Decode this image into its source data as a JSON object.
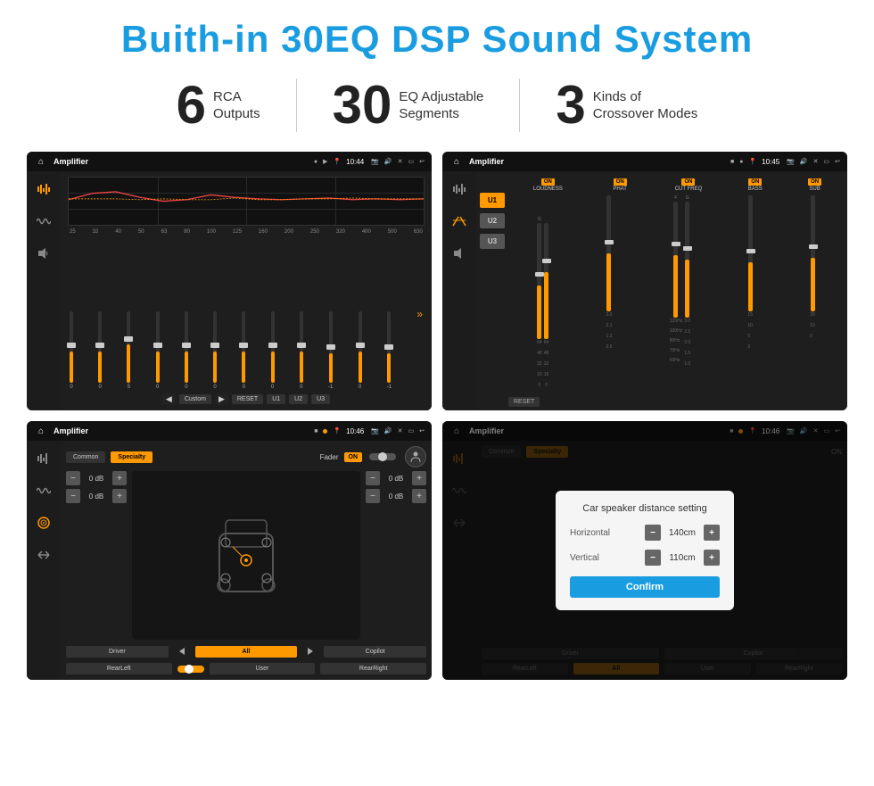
{
  "title": "Buith-in 30EQ DSP Sound System",
  "stats": [
    {
      "number": "6",
      "text_line1": "RCA",
      "text_line2": "Outputs"
    },
    {
      "number": "30",
      "text_line1": "EQ Adjustable",
      "text_line2": "Segments"
    },
    {
      "number": "3",
      "text_line1": "Kinds of",
      "text_line2": "Crossover Modes"
    }
  ],
  "screens": {
    "eq_screen": {
      "status_bar": {
        "app": "Amplifier",
        "time": "10:44"
      },
      "eq_labels": [
        "25",
        "32",
        "40",
        "50",
        "63",
        "80",
        "100",
        "125",
        "160",
        "200",
        "250",
        "320",
        "400",
        "500",
        "630"
      ],
      "eq_values": [
        "0",
        "0",
        "0",
        "5",
        "0",
        "0",
        "0",
        "0",
        "0",
        "0",
        "0",
        "-1",
        "0",
        "-1"
      ],
      "buttons": [
        "Custom",
        "RESET",
        "U1",
        "U2",
        "U3"
      ]
    },
    "crossover_screen": {
      "status_bar": {
        "app": "Amplifier",
        "time": "10:45"
      },
      "presets": [
        "U1",
        "U2",
        "U3"
      ],
      "channels": [
        {
          "name": "LOUDNESS",
          "toggle": "ON"
        },
        {
          "name": "PHAT",
          "toggle": "ON"
        },
        {
          "name": "CUT FREQ",
          "toggle": "ON"
        },
        {
          "name": "BASS",
          "toggle": "ON"
        },
        {
          "name": "SUB",
          "toggle": "ON"
        }
      ],
      "reset_label": "RESET"
    },
    "fader_screen": {
      "status_bar": {
        "app": "Amplifier",
        "time": "10:46"
      },
      "tabs": [
        "Common",
        "Specialty"
      ],
      "fader_label": "Fader",
      "fader_toggle": "ON",
      "db_rows": [
        {
          "value": "0 dB"
        },
        {
          "value": "0 dB"
        },
        {
          "value": "0 dB"
        },
        {
          "value": "0 dB"
        }
      ],
      "bottom_buttons": [
        "Driver",
        "All",
        "Copilot",
        "RearLeft",
        "User",
        "RearRight"
      ]
    },
    "distance_screen": {
      "status_bar": {
        "app": "Amplifier",
        "time": "10:46"
      },
      "tabs": [
        "Common",
        "Specialty"
      ],
      "dialog": {
        "title": "Car speaker distance setting",
        "horizontal_label": "Horizontal",
        "horizontal_value": "140cm",
        "vertical_label": "Vertical",
        "vertical_value": "110cm",
        "confirm_label": "Confirm"
      },
      "bottom_buttons": [
        "Driver",
        "Copilot",
        "RearLeft",
        "User",
        "RearRight"
      ]
    }
  },
  "icons": {
    "home": "⌂",
    "back": "↩",
    "settings": "⚙",
    "location": "⊙",
    "speaker": "♪",
    "eq": "≡",
    "wave": "~",
    "arrows": "⇄",
    "minus": "−",
    "plus": "+"
  }
}
